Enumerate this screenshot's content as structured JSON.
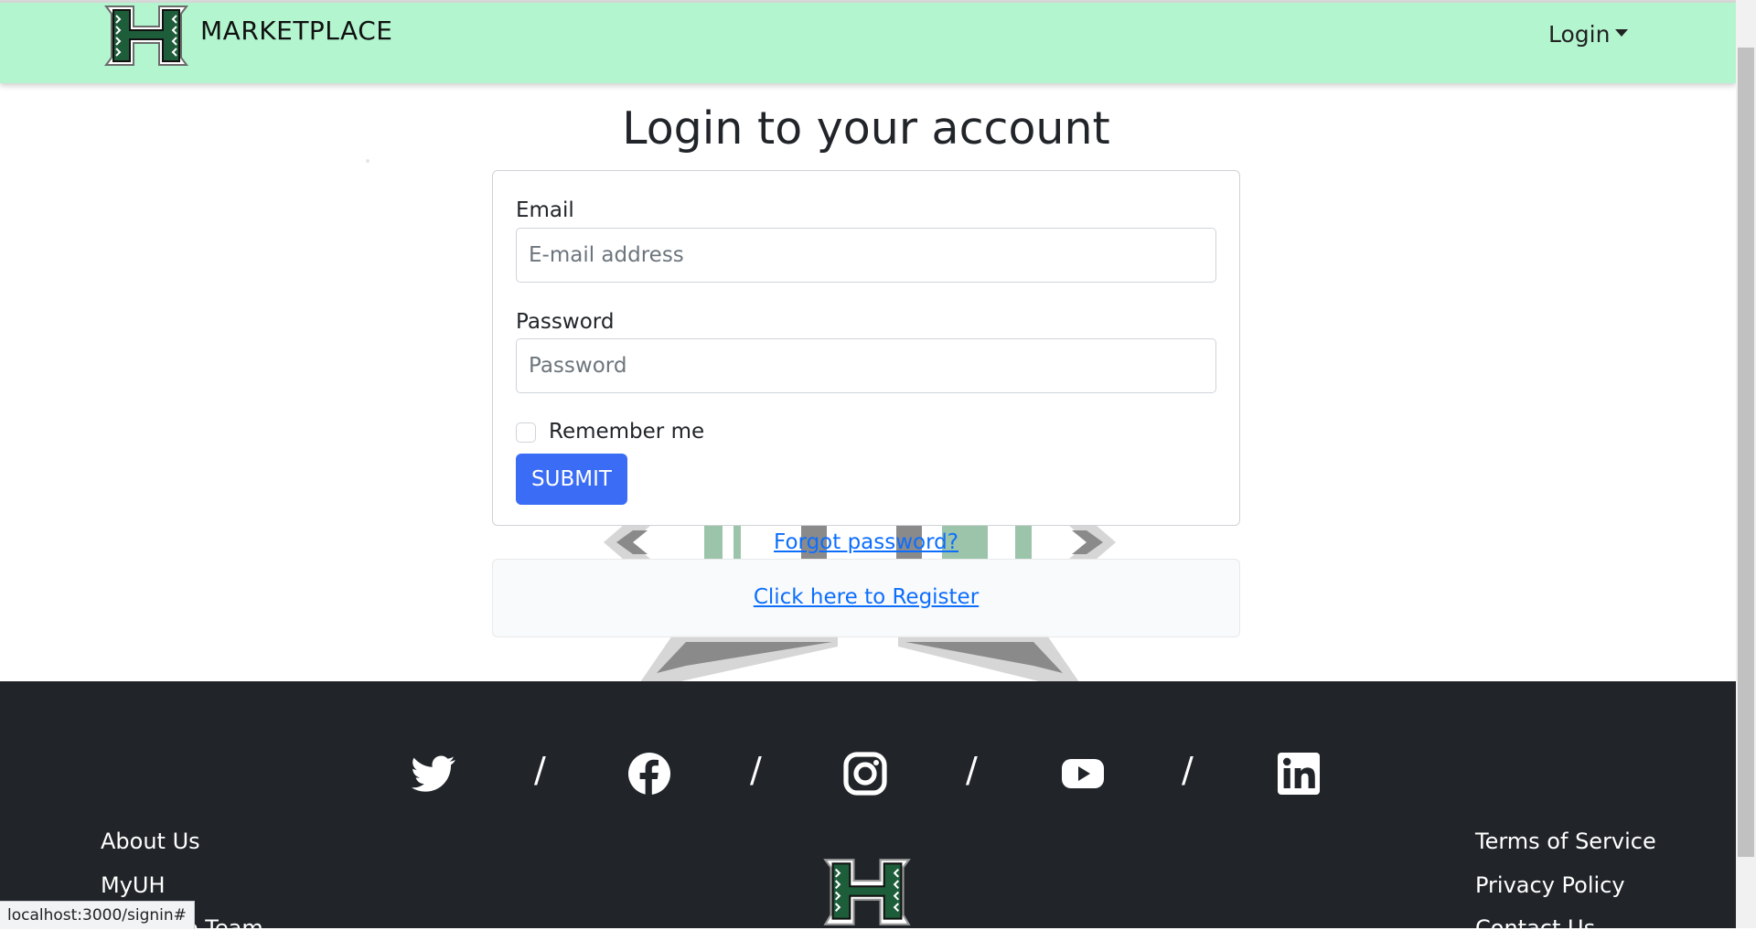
{
  "navbar": {
    "brand": "MARKETPLACE",
    "login_label": "Login"
  },
  "page": {
    "title": "Login to your account"
  },
  "form": {
    "email_label": "Email",
    "email_placeholder": "E-mail address",
    "password_label": "Password",
    "password_placeholder": "Password",
    "remember_label": "Remember me",
    "submit_label": "SUBMIT"
  },
  "links": {
    "forgot": "Forgot password?",
    "register": "Click here to Register"
  },
  "footer": {
    "social": [
      "twitter-icon",
      "facebook-icon",
      "instagram-icon",
      "youtube-icon",
      "linkedin-icon"
    ],
    "separator": "/",
    "left_links": [
      "About Us",
      "MyUH",
      "Meet the Team"
    ],
    "right_links": [
      "Terms of Service",
      "Privacy Policy",
      "Contact Us"
    ]
  },
  "status_bar": {
    "url": "localhost:3000/signin#"
  },
  "colors": {
    "navbar_bg": "#b3f5cf",
    "footer_bg": "#212529",
    "primary": "#3b6cf5",
    "link": "#0d6efd",
    "logo_green": "#1e5d3a"
  }
}
